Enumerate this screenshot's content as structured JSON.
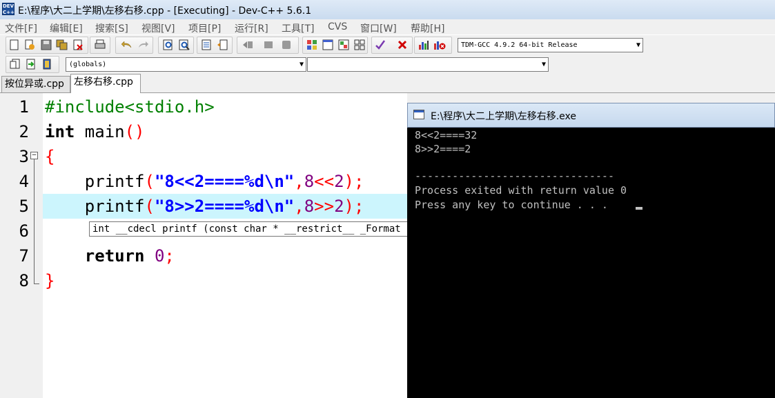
{
  "window": {
    "title": "E:\\程序\\大二上学期\\左移右移.cpp - [Executing] - Dev-C++ 5.6.1",
    "app_icon_text": "DEV C++"
  },
  "menu": [
    "文件[F]",
    "编辑[E]",
    "搜索[S]",
    "视图[V]",
    "项目[P]",
    "运行[R]",
    "工具[T]",
    "CVS",
    "窗口[W]",
    "帮助[H]"
  ],
  "toolbar": {
    "compiler_select": "TDM-GCC 4.9.2 64-bit Release",
    "scope_select": "(globals)",
    "member_select": ""
  },
  "tabs": [
    {
      "label": "按位异或.cpp",
      "active": false
    },
    {
      "label": "左移右移.cpp",
      "active": true
    }
  ],
  "editor": {
    "line_numbers": [
      "1",
      "2",
      "3",
      "4",
      "5",
      "6",
      "7",
      "8"
    ],
    "lines": {
      "l1_include": "#include<stdio.h>",
      "l2_kw": "int",
      "l2_rest": " main",
      "l2_parens": "()",
      "l3_brace": "{",
      "l4_indent": "    printf",
      "l4_open": "(",
      "l4_str": "\"8<<2====%d\\n\"",
      "l4_comma": ",",
      "l4_num1": "8",
      "l4_op": "<<",
      "l4_num2": "2",
      "l4_close": ");",
      "l5_indent": "    printf",
      "l5_open": "(",
      "l5_str": "\"8>>2====%d\\n\"",
      "l5_comma": ",",
      "l5_num1": "8",
      "l5_op": ">>",
      "l5_num2": "2",
      "l5_close": ");",
      "l7_kw": "    return",
      "l7_num": " 0",
      "l7_semi": ";",
      "l8_brace": "}"
    },
    "tooltip": "int __cdecl printf (const char * __restrict__ _Format"
  },
  "console": {
    "title": "E:\\程序\\大二上学期\\左移右移.exe",
    "lines": [
      "8<<2====32",
      "8>>2====2",
      "",
      "--------------------------------",
      "Process exited with return value 0",
      "Press any key to continue . . . "
    ]
  },
  "colors": {
    "keyword": "#000000",
    "preprocessor": "#008000",
    "string": "#0000ff",
    "number": "#800080",
    "symbol": "#ff0000",
    "current_line": "#ccf5fd",
    "console_bg": "#000000",
    "console_text": "#c0c0c0"
  }
}
